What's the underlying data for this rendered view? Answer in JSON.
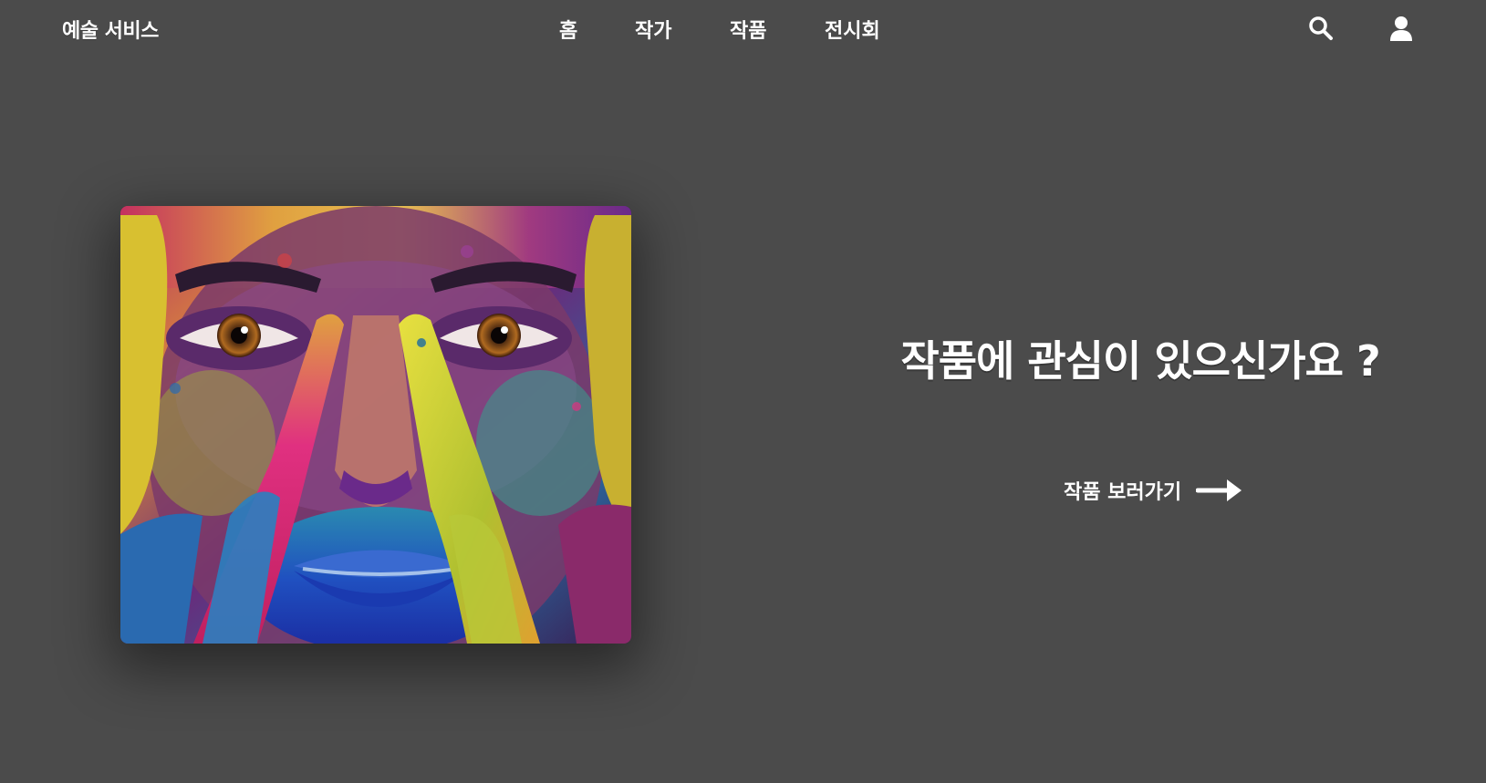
{
  "header": {
    "logo": "예술 서비스",
    "nav": {
      "home": "홈",
      "artist": "작가",
      "works": "작품",
      "exhibition": "전시회"
    },
    "icons": {
      "search": "search-icon",
      "user": "user-icon"
    }
  },
  "hero": {
    "title": "작품에 관심이 있으신가요 ?",
    "cta_label": "작품 보러가기",
    "cta_icon": "arrow-right-icon"
  },
  "colors": {
    "background": "#4b4b4b",
    "text": "#ffffff"
  }
}
